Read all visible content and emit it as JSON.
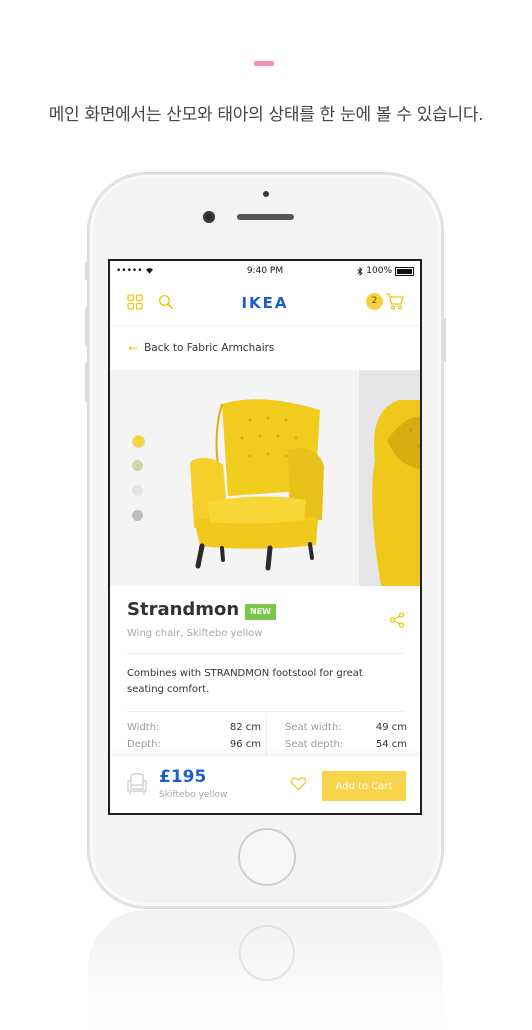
{
  "caption": "메인 화면에서는 산모와 태아의 상태를 한 눈에 볼 수 있습니다.",
  "status_bar": {
    "signal": "•••••",
    "time": "9:40 PM",
    "battery": "100%"
  },
  "navbar": {
    "logo": "IKEA",
    "cart_count": "2"
  },
  "back_link": {
    "label": "Back to Fabric Armchairs"
  },
  "gallery": {
    "color_swatches": [
      "#f7d23e",
      "#c9d9a2",
      "#e3e3e3",
      "#bdbdbd"
    ]
  },
  "product": {
    "name": "Strandmon",
    "badge": "NEW",
    "subtitle": "Wing chair, Skiftebo yellow",
    "description": "Combines with STRANDMON footstool for great seating comfort."
  },
  "specs": {
    "left": [
      {
        "label": "Width:",
        "value": "82 cm"
      },
      {
        "label": "Depth:",
        "value": "96 cm"
      }
    ],
    "right": [
      {
        "label": "Seat width:",
        "value": "49 cm"
      },
      {
        "label": "Seat depth:",
        "value": "54 cm"
      }
    ]
  },
  "bottom_bar": {
    "price": "£195",
    "price_sub": "Skiftebo yellow",
    "add_to_cart": "Add to Cart"
  },
  "colors": {
    "accent_yellow": "#f2c413",
    "brand_blue": "#1d5fc9",
    "badge_green": "#79c84a",
    "caption_bar_pink": "#f48fb8"
  }
}
